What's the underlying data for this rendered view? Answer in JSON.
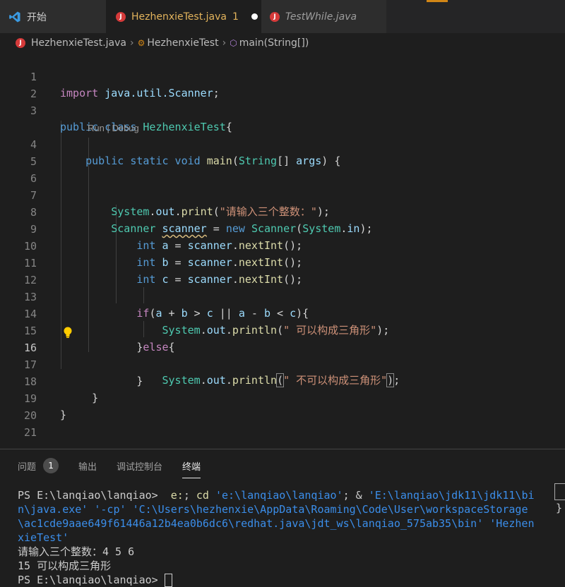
{
  "tabs": {
    "start": "开始",
    "active_file": "HezhenxieTest.java",
    "active_count": "1",
    "other_file": "TestWhile.java"
  },
  "breadcrumb": {
    "file": "HezhenxieTest.java",
    "class": "HezhenxieTest",
    "method": "main(String[])"
  },
  "editor": {
    "current_line": "16",
    "code_lens": "Run | Debug",
    "line_numbers": [
      "1",
      "2",
      "3",
      "4",
      "5",
      "6",
      "7",
      "8",
      "9",
      "10",
      "11",
      "12",
      "13",
      "14",
      "15",
      "16",
      "17",
      "18",
      "19",
      "20",
      "21"
    ],
    "code": {
      "l1_import": "import",
      "l1_pkg": "java.util.Scanner",
      "l3_public": "public",
      "l3_class": "class",
      "l3_name": "HezhenxieTest",
      "l4_mods": "public static void",
      "l4_main": "main",
      "l4_string": "String",
      "l4_args": "args",
      "l7_system": "System",
      "l7_out": "out",
      "l7_print": "print",
      "l7_str": "\"请输入三个整数：\"",
      "l8_scanner_type": "Scanner",
      "l8_scanner_var": "scanner",
      "l8_new": "new",
      "l8_scanner_ctor": "Scanner",
      "l8_system": "System",
      "l8_in": "in",
      "l9_var": "a",
      "l10_var": "b",
      "l11_var": "c",
      "int_kw": "int",
      "next_int": "nextInt",
      "scanner_ref": "scanner",
      "l13_if": "if",
      "l14_str": "\" 可以构成三角形\"",
      "l15_else": "else",
      "l16_str": "\" 不可以构成三角形\"",
      "println": "println"
    }
  },
  "panel": {
    "tabs": [
      "问题",
      "输出",
      "调试控制台",
      "终端"
    ],
    "problems_count": "1",
    "terminal": {
      "prompt": "PS E:\\lanqiao\\lanqiao>",
      "cmd1": "e:",
      "cmd2": "cd",
      "path1": "'e:\\lanqiao\\lanqiao'",
      "amp": "&",
      "java_exe": "'E:\\lanqiao\\jdk11\\jdk11\\bin\\java.exe'",
      "cp_flag": "'-cp'",
      "cp_path": "'C:\\Users\\hezhenxie\\AppData\\Roaming\\Code\\User\\workspaceStorage\\ac1cde9aae649f61446a12b4ea0b6dc6\\redhat.java\\jdt_ws\\lanqiao_575ab35\\bin'",
      "main_class": "'HezhenxieTest'",
      "output1": "请输入三个整数：4 5 6",
      "output2": "15 可以构成三角形",
      "prompt2": "PS E:\\lanqiao\\lanqiao>"
    }
  },
  "colors": {
    "editor_bg": "#1e1e1e",
    "tabbar_bg": "#252526",
    "keyword": "#569cd6",
    "class": "#4ec9b0",
    "function": "#dcdcaa",
    "variable": "#9cdcfe",
    "string": "#ce9178",
    "control": "#c586c0",
    "modified_tab": "#e2b35c"
  }
}
